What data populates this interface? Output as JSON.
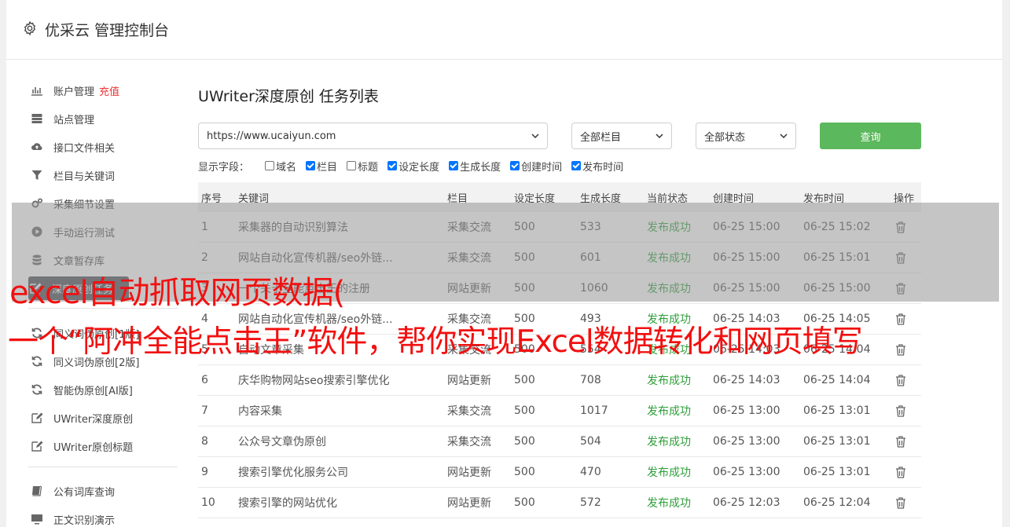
{
  "header": {
    "title": "优采云 管理控制台"
  },
  "sidebar": {
    "items": [
      {
        "label": "账户管理",
        "badge": "充值",
        "icon": "bar-chart-icon"
      },
      {
        "label": "站点管理",
        "icon": "server-icon"
      },
      {
        "label": "接口文件相关",
        "icon": "cloud-upload-icon"
      },
      {
        "label": "栏目与关键词",
        "icon": "filter-icon"
      },
      {
        "label": "采集细节设置",
        "icon": "gears-icon"
      },
      {
        "label": "手动运行测试",
        "icon": "play-circle-icon"
      },
      {
        "label": "文章暂存库",
        "icon": "database-icon"
      },
      {
        "label": "深度原创任务",
        "icon": "edit-icon"
      },
      {
        "label": "同义词伪原创[1版]",
        "icon": "refresh-icon"
      },
      {
        "label": "同义词伪原创[2版]",
        "icon": "refresh-icon"
      },
      {
        "label": "智能伪原创[AI版]",
        "icon": "refresh-icon"
      },
      {
        "label": "UWriter深度原创",
        "icon": "edit-icon"
      },
      {
        "label": "UWriter原创标题",
        "icon": "edit-icon"
      },
      {
        "label": "公有词库查询",
        "icon": "book-icon"
      },
      {
        "label": "正文识别演示",
        "icon": "monitor-icon"
      }
    ]
  },
  "main": {
    "title": "UWriter深度原创 任务列表",
    "filters": {
      "site": "https://www.ucaiyun.com",
      "category": "全部栏目",
      "status": "全部状态",
      "query_label": "查询"
    },
    "fields": {
      "label": "显示字段：",
      "options": [
        {
          "label": "域名",
          "checked": false
        },
        {
          "label": "栏目",
          "checked": true
        },
        {
          "label": "标题",
          "checked": false
        },
        {
          "label": "设定长度",
          "checked": true
        },
        {
          "label": "生成长度",
          "checked": true
        },
        {
          "label": "创建时间",
          "checked": true
        },
        {
          "label": "发布时间",
          "checked": true
        }
      ]
    },
    "table": {
      "headers": [
        "序号",
        "关键词",
        "栏目",
        "设定长度",
        "生成长度",
        "当前状态",
        "创建时间",
        "发布时间",
        "操作"
      ],
      "rows": [
        [
          "1",
          "采集器的自动识别算法",
          "采集交流",
          "500",
          "533",
          "发布成功",
          "06-25 15:00",
          "06-25 15:02"
        ],
        [
          "2",
          "网站自动化宣传机器/seo外链...",
          "采集交流",
          "500",
          "601",
          "发布成功",
          "06-25 15:00",
          "06-25 15:01"
        ],
        [
          "3",
          "一个关于全能点击王的注册",
          "网站更新",
          "500",
          "1060",
          "发布成功",
          "06-25 15:00",
          "06-25 15:00"
        ],
        [
          "4",
          "网站自动化宣传机器/seo外链...",
          "采集交流",
          "500",
          "493",
          "发布成功",
          "06-25 14:03",
          "06-25 14:05"
        ],
        [
          "5",
          "自动文章采集",
          "采集交流",
          "500",
          "554",
          "发布成功",
          "06-25 14:03",
          "06-25 14:04"
        ],
        [
          "6",
          "庆华购物网站seo搜索引擎优化",
          "网站更新",
          "500",
          "708",
          "发布成功",
          "06-25 14:03",
          "06-25 14:04"
        ],
        [
          "7",
          "内容采集",
          "采集交流",
          "500",
          "1017",
          "发布成功",
          "06-25 13:00",
          "06-25 13:01"
        ],
        [
          "8",
          "公众号文章伪原创",
          "采集交流",
          "500",
          "504",
          "发布成功",
          "06-25 13:00",
          "06-25 13:01"
        ],
        [
          "9",
          "搜索引擎优化服务公司",
          "网站更新",
          "500",
          "470",
          "发布成功",
          "06-25 13:00",
          "06-25 13:01"
        ],
        [
          "10",
          "搜索引擎的网站优化",
          "网站更新",
          "500",
          "572",
          "发布成功",
          "06-25 12:03",
          "06-25 12:04"
        ]
      ]
    }
  },
  "overlay": {
    "line1": "excel自动抓取网页数据(",
    "line2": "一个“阿冲全能点击王”软件，帮你实现Excel数据转化和网页填写"
  },
  "colors": {
    "accent_green": "#5cb85c",
    "status_green": "#2e9e3a",
    "overlay_red": "#f21010",
    "active_nav": "#4a4e58"
  }
}
